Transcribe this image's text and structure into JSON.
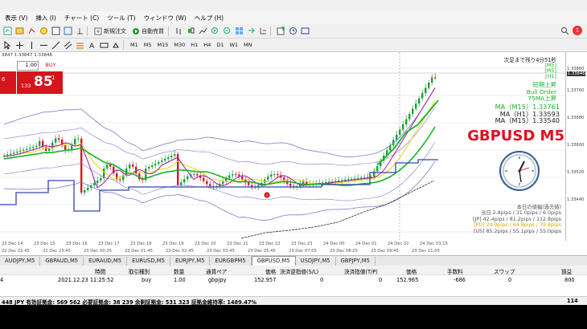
{
  "menu": [
    "表示 (V)",
    "挿入 (I)",
    "チャート (C)",
    "ツール (T)",
    "ウィンドウ (W)",
    "ヘルプ (H)"
  ],
  "toolbar": {
    "new_order": "新規注文",
    "auto_trade": "自動売買",
    "timeframes": [
      "M1",
      "M5",
      "M15",
      "M30",
      "H1",
      "H4",
      "D1",
      "W1",
      "MN"
    ],
    "alert_count": "1"
  },
  "chart": {
    "header": "3847 1.33847 1.33846",
    "symbol_label": "GBPUSD M5",
    "next_bar": "次足まで残り4分51秒",
    "tf_markers": [
      "[M5]",
      "[M5]",
      "[H1]"
    ],
    "signals": [
      "短期上昇",
      "Bull Order",
      "75MA上昇"
    ],
    "ma_lines": [
      "MA（M15）1.33761",
      "MA（H1）1.33593",
      "MA（M15）1.33540",
      "MA（H1）1.33776"
    ],
    "session_title": "本日の値幅(過去値)",
    "sessions": [
      "当日 2.8pips / 31.0pips / 6.0pips",
      "[JP] 42.4pips / 81.2pips / 112.8pips",
      "[EU] 29.9pips / 64.8pips / 79.8pips",
      "[US] 85.2pips / 55.1pips / 55.0pips"
    ],
    "price_ticks": [
      "1.33860",
      "1.33846",
      "1.33760",
      "1.33680",
      "1.33600",
      "1.33520",
      "1.33440"
    ],
    "x_ticks": [
      "23 Dec 14",
      "23 Dec 15",
      "23 Dec 16",
      "23 Dec 17",
      "23 Dec 18",
      "23 Dec 19",
      "23 Dec 20",
      "23 Dec 21",
      "23 Dec 22",
      "23 Dec 23",
      "24 Dec 00",
      "24 Dec 01",
      "24 Dec 02",
      "24 Dec 03:15"
    ],
    "x_ticks2": [
      "22 Dec 21:45",
      "22 Dec 23:45",
      "23 Dec 00:25",
      "23 Dec 01:45",
      "23 Dec 02:45",
      "23 Dec 03:45",
      "23 Dec 05:45",
      "23 Dec 07:05",
      "23 Dec 08:25",
      "23 Dec 09:45",
      "23 Dec 11:05"
    ],
    "colors": {
      "up": "#1a9e3a",
      "down": "#d01a24",
      "ma_green": "#19b22b",
      "ma_yellow": "#e8d800",
      "ma_purple": "#9a1aa8",
      "bands": "#7b7bd0",
      "label_red": "#e01020",
      "label_green": "#19b22b"
    }
  },
  "oneclick": {
    "lot": "1.00",
    "buy_label": "BUY",
    "sell_small": "6",
    "buy_small": "133",
    "buy_big": "85",
    "buy_sup": "1"
  },
  "tabs": [
    "AUDJPY,M5",
    "GBPAUD,M5",
    "EURAUD,M5",
    "EURUSD,M5",
    "EURJPY,M5",
    "EURGBPM5",
    "GBPUSD,M5",
    "USDJPY,M5",
    "GBPJPY,M5"
  ],
  "active_tab": "GBPUSD,M5",
  "terminal": {
    "headers": [
      "時間",
      "取引種別",
      "数量",
      "通貨ペア",
      "価格",
      "決済逆指値(S/L)",
      "決済指値(T/P)",
      "価格",
      "手数料",
      "スワップ",
      "損益"
    ],
    "row": [
      "2021.12.23 11:25:52",
      "buy",
      "1.00",
      "gbpjpy",
      "152.957",
      "0",
      "0",
      "152.965",
      "-686",
      "0",
      "800"
    ],
    "row_id": "4"
  },
  "status": {
    "text": "448 JPY  有効証拠金: 569 562  必要証拠金: 38 239  余剰証拠金: 531 323  証拠金維持率: 1489.47%",
    "right": "114"
  }
}
